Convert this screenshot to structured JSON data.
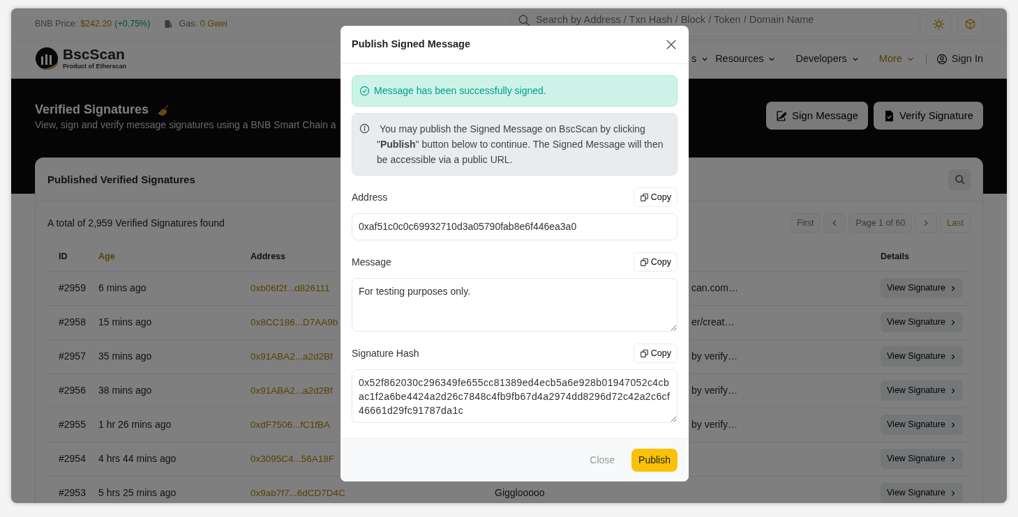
{
  "topbar": {
    "price_label": "BNB Price:",
    "price": "$242.20",
    "change": "(+0.75%)",
    "gas_label": "Gas:",
    "gas_value": "0 Gwei",
    "search_placeholder": "Search by Address / Txn Hash / Block / Token / Domain Name"
  },
  "brand": {
    "name": "BscScan",
    "tagline": "Product of Etherscan"
  },
  "nav": [
    {
      "label": "s",
      "selected": false
    },
    {
      "label": "Resources",
      "selected": false
    },
    {
      "label": "Developers",
      "selected": false
    },
    {
      "label": "More",
      "selected": true
    }
  ],
  "sign_in": "Sign In",
  "hero": {
    "title": "Verified Signatures",
    "subtitle": "View, sign and verify message signatures using a BNB Smart Chain a",
    "buttons": [
      {
        "label": "Sign Message",
        "kind": "sign"
      },
      {
        "label": "Verify Signature",
        "kind": "verify"
      }
    ]
  },
  "card": {
    "title": "Published Verified Signatures",
    "total": "A total of 2,959 Verified Signatures found",
    "pagination": [
      {
        "kind": "text",
        "label": "First",
        "disabled": true
      },
      {
        "kind": "prev",
        "disabled": true
      },
      {
        "kind": "text",
        "label": "Page 1 of 60",
        "disabled": true
      },
      {
        "kind": "next",
        "disabled": false
      },
      {
        "kind": "text",
        "label": "Last",
        "disabled": false
      }
    ],
    "columns": [
      {
        "label": "ID",
        "sorted": false
      },
      {
        "label": "Age",
        "sorted": true
      },
      {
        "label": "Address",
        "sorted": false
      },
      {
        "label": "Details",
        "sorted": false
      }
    ],
    "rows": [
      {
        "id": "#2959",
        "age": "6 mins ago",
        "address": "0xb06f2f...d826111",
        "message": "can.com…",
        "message_clipped": true,
        "action": "View Signature"
      },
      {
        "id": "#2958",
        "age": "15 mins ago",
        "address": "0x8CC186...D7AA9b",
        "message": "er/creat…",
        "message_clipped": true,
        "action": "View Signature"
      },
      {
        "id": "#2957",
        "age": "35 mins ago",
        "address": "0x91ABA2...a2d2Bf",
        "message": "by verify…",
        "message_clipped": true,
        "action": "View Signature"
      },
      {
        "id": "#2956",
        "age": "38 mins ago",
        "address": "0x91ABA2...a2d2Bf",
        "message": "by verify…",
        "message_clipped": true,
        "action": "View Signature"
      },
      {
        "id": "#2955",
        "age": "1 hr 26 mins ago",
        "address": "0xdF7506...fC1fBA",
        "message": "by verify…",
        "message_clipped": true,
        "action": "View Signature"
      },
      {
        "id": "#2954",
        "age": "4 hrs 44 mins ago",
        "address": "0x3095C4...56A18F",
        "action": "View Signature"
      },
      {
        "id": "#2953",
        "age": "5 hrs 25 mins ago",
        "address": "0x9ab7f7...6dCD7D4C",
        "message": "Gigglooooo",
        "message_clipped": false,
        "action": "View Signature"
      }
    ]
  },
  "modal": {
    "title": "Publish Signed Message",
    "success": "Message has been successfully signed.",
    "info": "You may publish the Signed Message on BscScan by clicking \"**Publish**\" button below to continue. The Signed Message will then be accessible via a public URL.",
    "fields": [
      {
        "label": "Address",
        "kind": "input",
        "value": "0xaf51c0c0c69932710d3a05790fab8e6f446ea3a0",
        "copy": "Copy"
      },
      {
        "label": "Message",
        "kind": "textarea",
        "value": "For testing purposes only.",
        "copy": "Copy"
      },
      {
        "label": "Signature Hash",
        "kind": "textarea",
        "value": "0x52f862030c296349fe655cc81389ed4ecb5a6e928b01947052c4cbac1f2a6be4424a2d26c7848c4fb9fb67d4a2974dd8296d72c42a2c6cf46661d29fc91787da1c",
        "copy": "Copy"
      }
    ],
    "buttons": [
      {
        "label": "Close",
        "kind": "secondary"
      },
      {
        "label": "Publish",
        "kind": "primary"
      }
    ]
  }
}
